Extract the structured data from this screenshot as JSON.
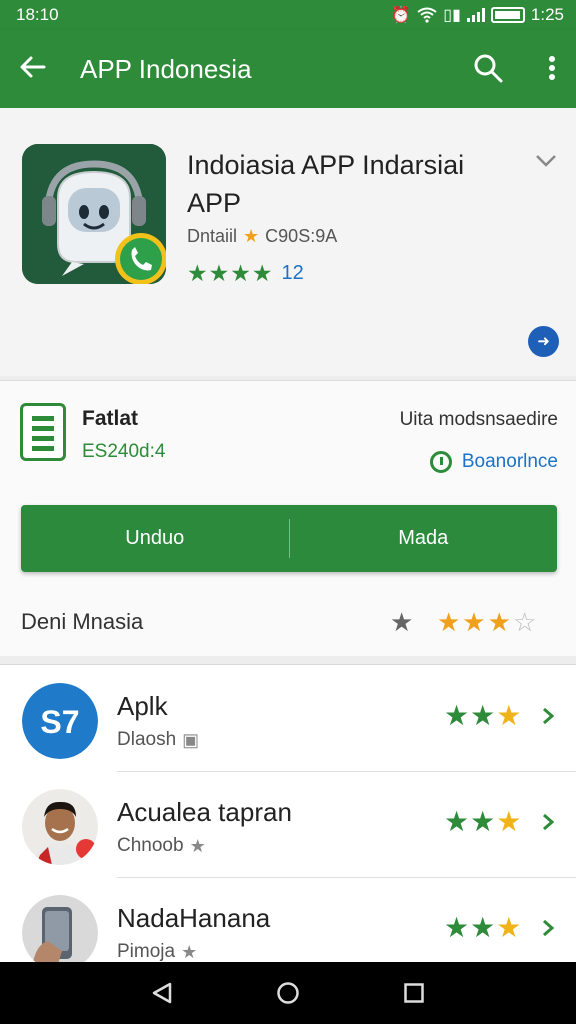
{
  "status_bar": {
    "time": "18:10",
    "right_time": "1:25",
    "icons": [
      "alarm-icon",
      "wifi-icon",
      "sim-icon",
      "signal-icon",
      "battery-icon"
    ]
  },
  "app_bar": {
    "title": "APP Indonesia",
    "icons": [
      "back-arrow-icon",
      "search-icon",
      "more-vert-icon"
    ]
  },
  "app": {
    "name": "Indoiasia APP Indarsiai APP",
    "developer": "Dntaiil",
    "developer_code": "C90S:9A",
    "rating_stars": "★★★★",
    "rating_count": "12"
  },
  "info": {
    "title": "Fatlat",
    "subtitle": "ES240d:4",
    "right_label": "Uita modsnsaedire",
    "link_label": "Boanorlnce"
  },
  "actions": {
    "left_label": "Unduo",
    "right_label": "Mada"
  },
  "rate": {
    "label": "Deni Mnasia",
    "single_star": "★",
    "stars_filled": "★★★",
    "stars_empty": "☆",
    "value": 3
  },
  "list": [
    {
      "name": "Aplk",
      "sub": "Dlaosh",
      "sub_icon": "image-icon",
      "stars_green": "★★",
      "stars_yellow": "★",
      "avatar": "app-logo"
    },
    {
      "name": "Acualea tapran",
      "sub": "Chnoob",
      "sub_icon": "star-icon",
      "stars_green": "★★",
      "stars_yellow": "★",
      "avatar": "person-photo"
    },
    {
      "name": "NadaHanana",
      "sub": "Pimoja",
      "sub_icon": "star-icon",
      "stars_green": "★★",
      "stars_yellow": "★",
      "avatar": "phone-photo"
    }
  ],
  "colors": {
    "primary": "#2e8b3a",
    "accent_blue": "#1a73c8",
    "star_yellow": "#f0a01a"
  }
}
